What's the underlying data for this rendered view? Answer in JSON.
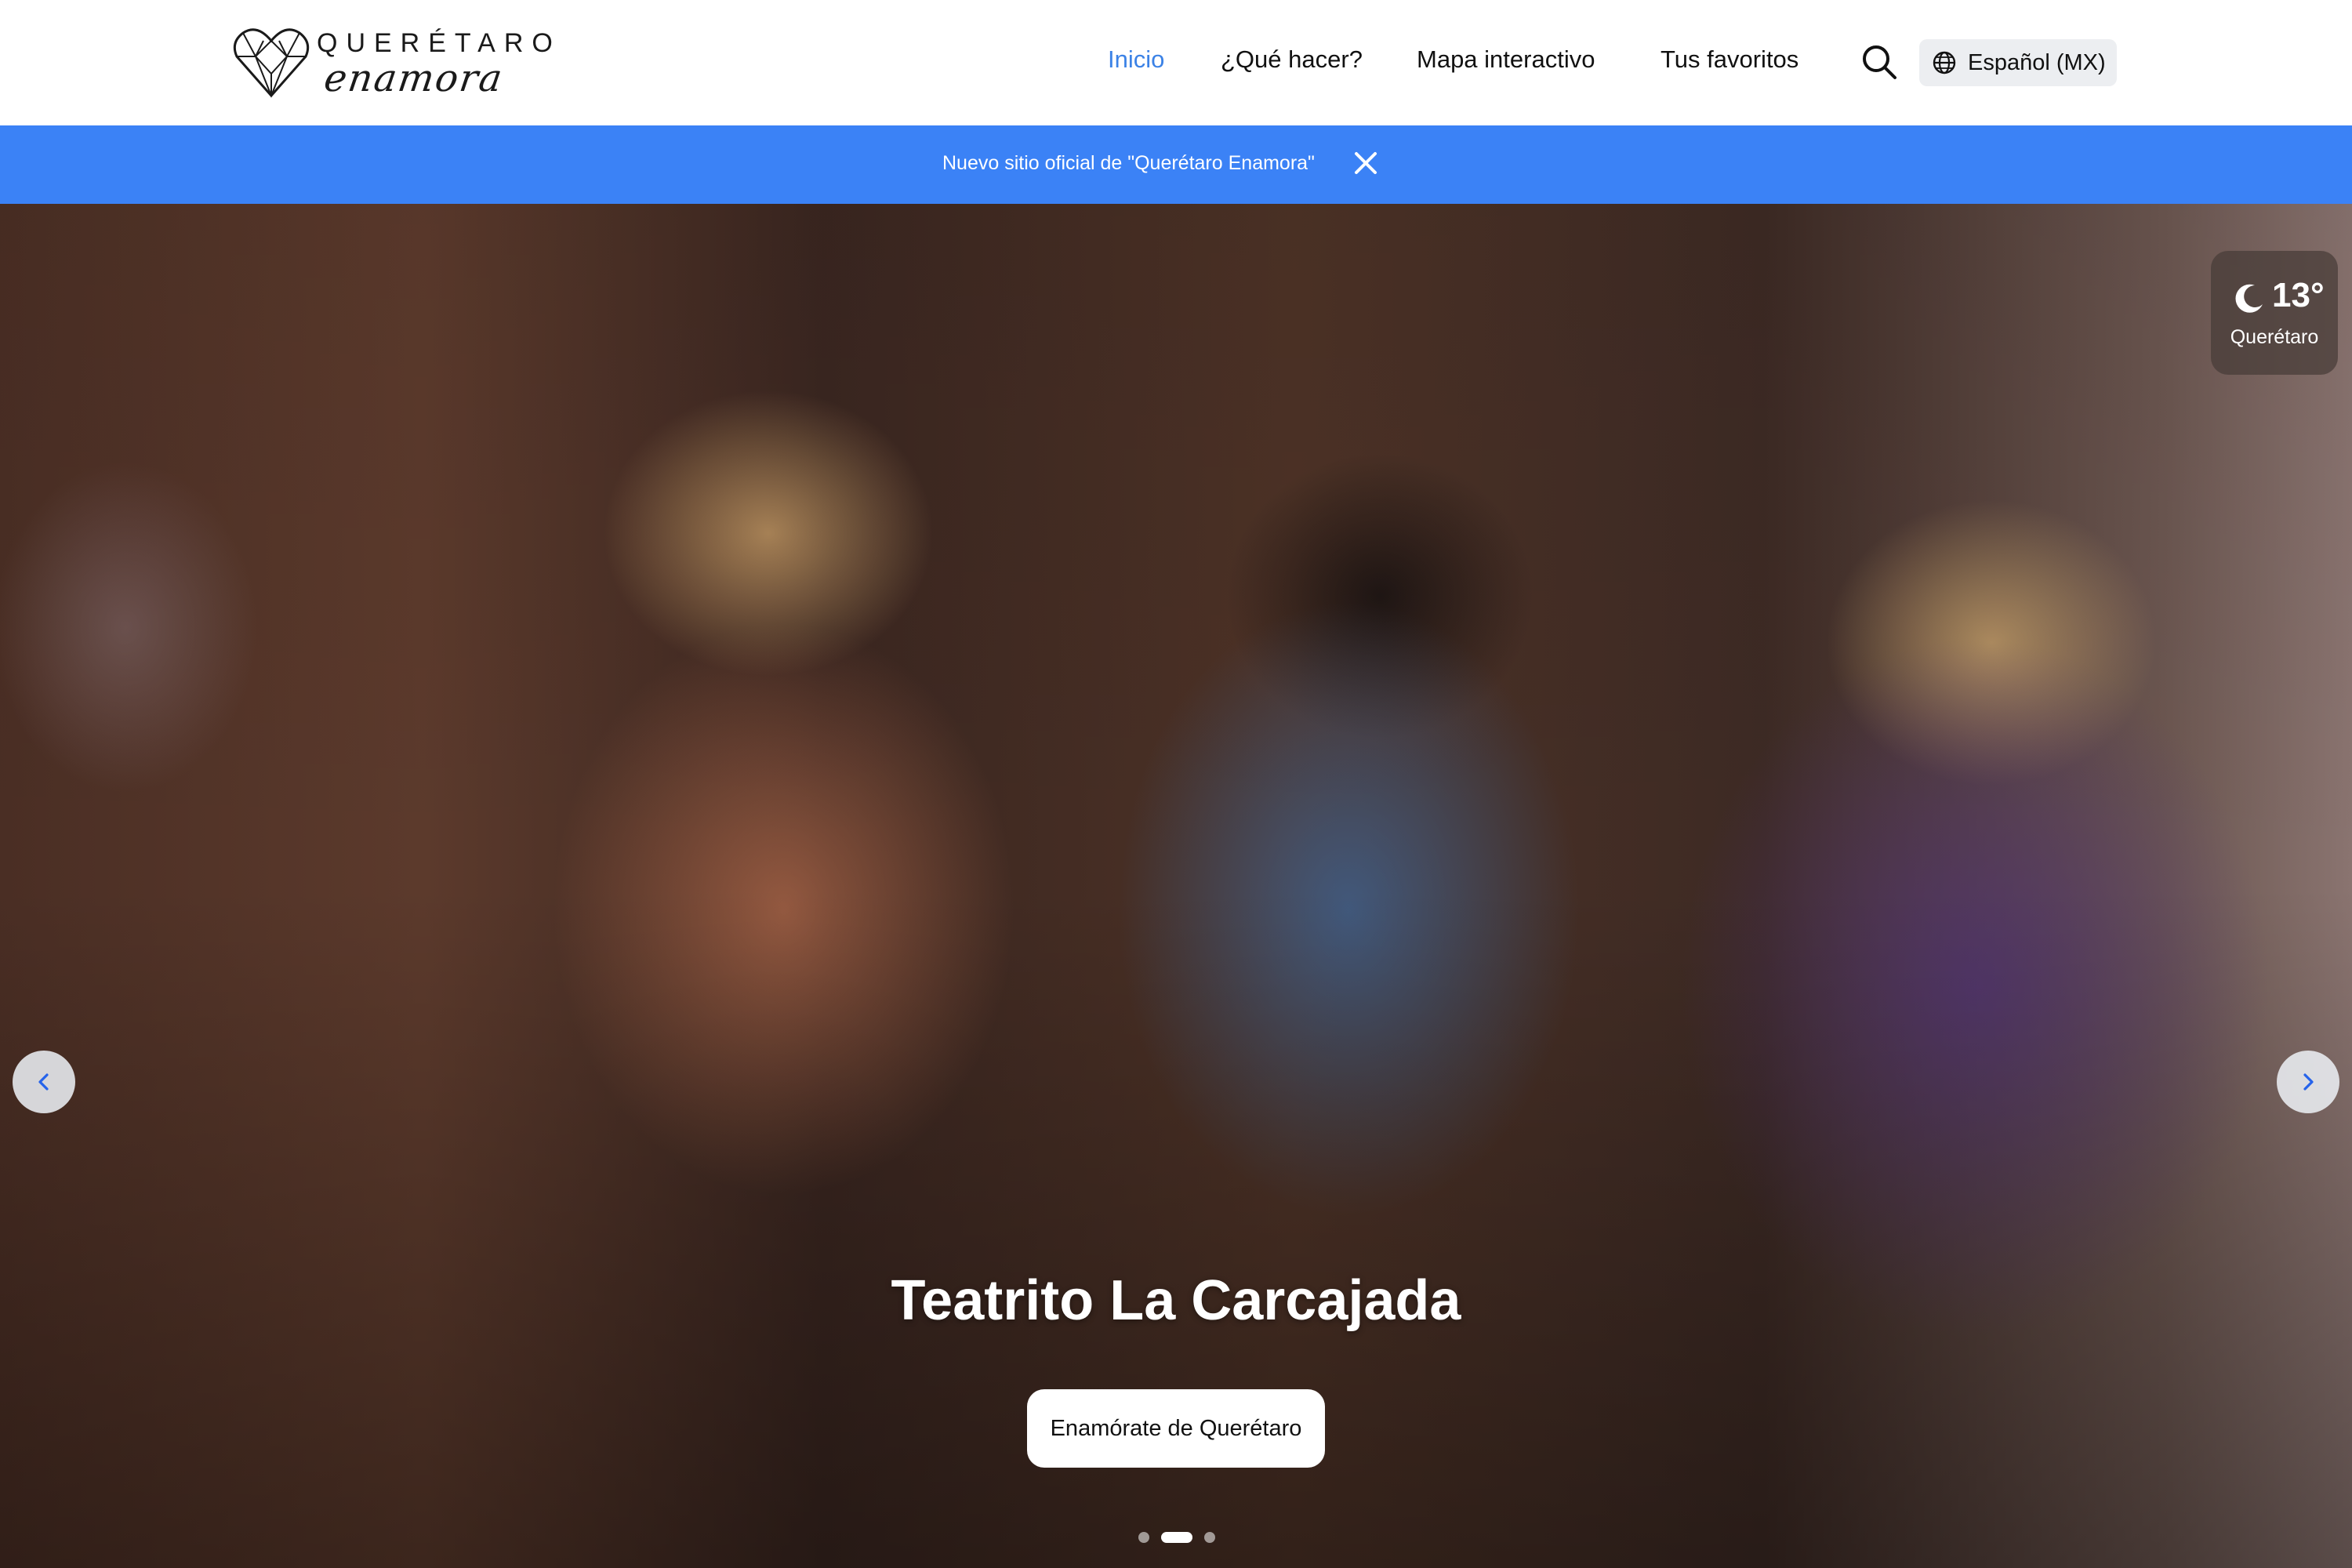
{
  "brand": {
    "title": "QUERÉTARO",
    "script": "enamora"
  },
  "nav": {
    "items": [
      {
        "label": "Inicio",
        "active": true
      },
      {
        "label": "¿Qué hacer?",
        "active": false
      },
      {
        "label": "Mapa interactivo",
        "active": false
      },
      {
        "label": "Tus favoritos",
        "active": false
      }
    ],
    "search_icon": "search-icon",
    "language": {
      "label": "Español (MX)",
      "icon": "globe-icon"
    }
  },
  "banner": {
    "text": "Nuevo sitio oficial de \"Querétaro Enamora\"",
    "close_icon": "close-icon",
    "color": "#3b82f6"
  },
  "hero": {
    "title": "Teatrito La Carcajada",
    "cta_label": "Enamórate de Querétaro",
    "weather": {
      "temperature": "13°",
      "city": "Querétaro",
      "icon": "moon-icon"
    },
    "slides": {
      "count": 3,
      "active": 2
    },
    "prev_icon": "chevron-left-icon",
    "next_icon": "chevron-right-icon"
  },
  "colors": {
    "accent": "#3b82e6",
    "text": "#111111"
  }
}
